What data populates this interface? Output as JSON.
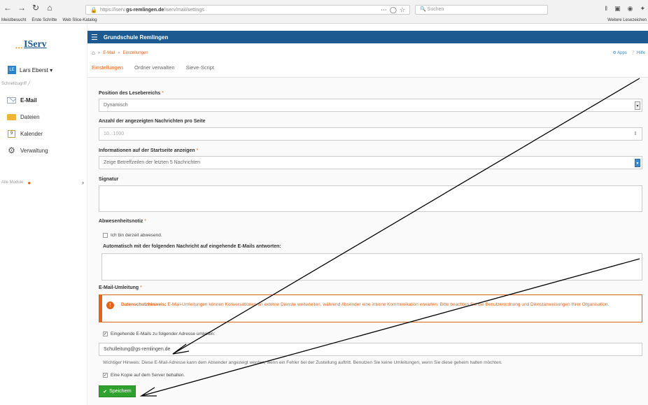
{
  "browser": {
    "url_prefix": "https://iserv.",
    "url_host": "gs-remlingen.de",
    "url_path": "/iserv/mail/settings",
    "search_placeholder": "Suchen",
    "bookmarks": [
      "Meistbesucht",
      "Erste Schritte",
      "Web Slice-Katalog"
    ],
    "bookmarks_right": "Weitere Lesezeichen"
  },
  "sidebar": {
    "logo": "IServ",
    "user_initials": "LE",
    "user_name": "Lars Eberst ▾",
    "quick_access": "Schnellzugriff ╱",
    "items": [
      {
        "label": "E-Mail",
        "icon": "mail-icon"
      },
      {
        "label": "Dateien",
        "icon": "folder-icon"
      },
      {
        "label": "Kalender",
        "icon": "calendar-icon"
      },
      {
        "label": "Verwaltung",
        "icon": "gear-icon"
      }
    ],
    "calendar_day": "9",
    "all_modules": "Alle Module"
  },
  "header": {
    "school": "Grundschule Remlingen",
    "breadcrumb": [
      "E-Mail",
      "Einstellungen"
    ],
    "links": [
      "Apps",
      "Hilfe"
    ],
    "tabs": [
      "Einstellungen",
      "Ordner verwalten",
      "Sieve-Script"
    ]
  },
  "form": {
    "position_label": "Position des Lesebereichs",
    "position_value": "Dynamisch",
    "count_label": "Anzahl der angezeigten Nachrichten pro Seite",
    "count_placeholder": "10...1000",
    "startpage_label": "Informationen auf der Startseite anzeigen",
    "startpage_value": "Zeige Betreffzeilen der letzten 5 Nachrichten",
    "signature_label": "Signatur",
    "absence_label": "Abwesenheitsnotiz",
    "absence_checkbox": "Ich bin derzeit abwesend.",
    "autoreply_label": "Automatisch mit der folgenden Nachricht auf eingehende E-Mails antworten:",
    "redirect_label": "E-Mail-Umleitung",
    "warning_title": "Datenschutzhinweis:",
    "warning_text": "E-Mail-Umleitungen können Konversationen an externe Dienste weiterleiten, während Absender eine interne Kommunikation erwarten. Bitte beachten Sie die Benutzerordnung und Dienstanweisungen Ihrer Organisation.",
    "forward_checkbox": "Eingehende E-Mails zu folgender Adresse umleiten:",
    "forward_address": "Schulleitung@gs-remlingen.de",
    "hint": "Wichtiger Hinweis: Diese E-Mail-Adresse kann dem Absender angezeigt werden, wenn ein Fehler bei der Zustellung auftritt. Benutzen Sie keine Umleitungen, wenn Sie diese geheim halten möchten.",
    "keep_copy_checkbox": "Eine Kopie auf dem Server behalten.",
    "save_button": "Speichern"
  },
  "colors": {
    "brand": "#1d5a8f",
    "accent": "#e0641a",
    "save": "#2ea12e"
  }
}
